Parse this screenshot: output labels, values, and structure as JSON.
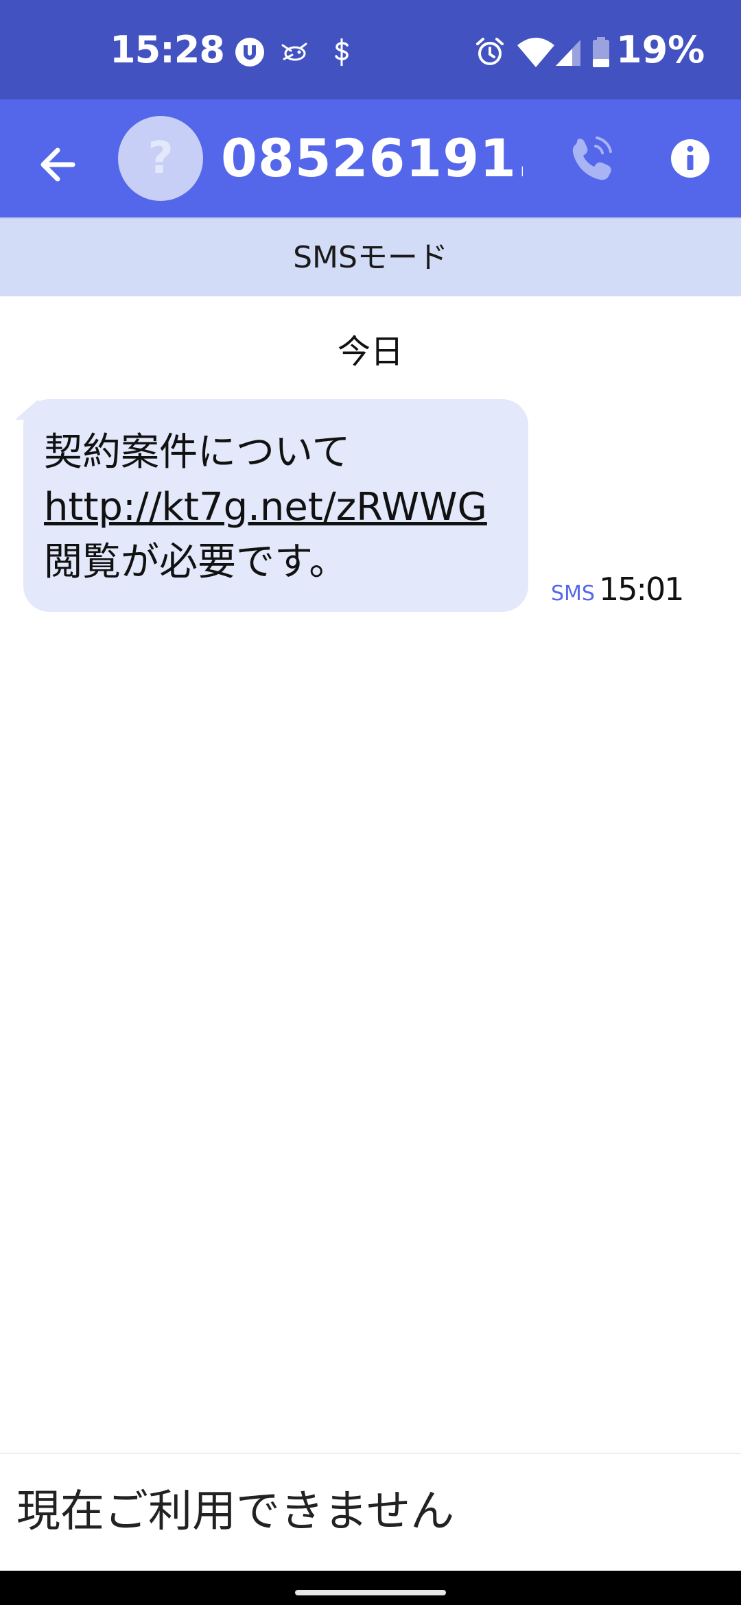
{
  "status_bar": {
    "time": "15:28",
    "battery_percent": "19%",
    "icons": [
      "utorrent-icon",
      "bird-app-icon",
      "dollar-app-icon",
      "alarm-icon",
      "wifi-icon",
      "signal-icon",
      "battery-icon"
    ]
  },
  "app_bar": {
    "contact_name": "08526191...",
    "avatar_glyph": "?",
    "icons": [
      "back-arrow-icon",
      "phone-call-icon",
      "info-icon"
    ]
  },
  "mode_banner": {
    "label": "SMSモード"
  },
  "conversation": {
    "date_separator": "今日",
    "messages": [
      {
        "line1": "契約案件について",
        "link": "http://kt7g.net/zRWWG",
        "line3": "閲覧が必要です。",
        "type": "SMS",
        "time": "15:01"
      }
    ]
  },
  "compose": {
    "status_text": "現在ご利用できません"
  },
  "colors": {
    "status_bar": "#4352c1",
    "app_bar": "#5467ea",
    "banner": "#d3dcf7",
    "bubble": "#e3e8fa",
    "accent": "#5467ea"
  }
}
